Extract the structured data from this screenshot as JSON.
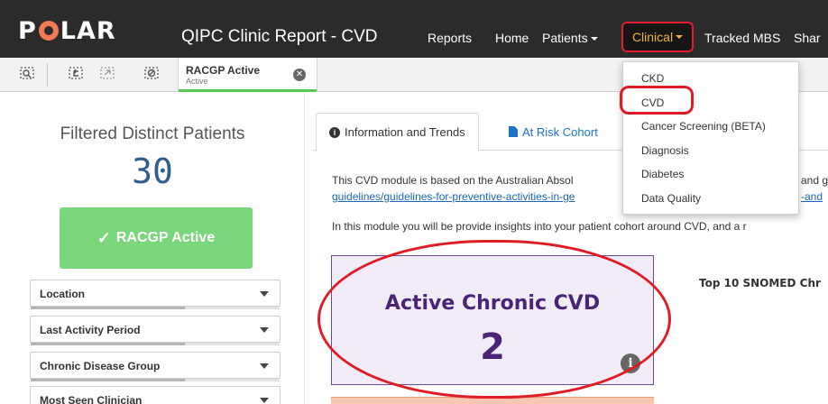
{
  "navbar": {
    "logo_text": "POLAR",
    "app_title": "QIPC Clinic Report - CVD",
    "items": [
      {
        "label": "Reports"
      },
      {
        "label": "Home"
      },
      {
        "label": "Patients"
      },
      {
        "label": "Clinical"
      },
      {
        "label": "Tracked MBS"
      },
      {
        "label": "Shar"
      }
    ],
    "active_color": "#f0b33c"
  },
  "toolbar": {
    "icons": [
      "lasso-select-icon",
      "back-step-icon",
      "forward-step-icon",
      "clear-selections-icon"
    ],
    "selection": {
      "title": "RACGP Active",
      "subtitle": "Active"
    }
  },
  "sidebar": {
    "counter_title": "Filtered Distinct Patients",
    "counter_value": "30",
    "racgp_button": "RACGP Active",
    "filters": [
      {
        "label": "Location"
      },
      {
        "label": "Last Activity Period"
      },
      {
        "label": "Chronic Disease Group"
      },
      {
        "label": "Most Seen Clinician"
      }
    ]
  },
  "tabs": [
    {
      "label": "Information and Trends"
    },
    {
      "label": "At Risk Cohort"
    }
  ],
  "content": {
    "line1": "This CVD module is based on the Australian Absol",
    "line1_right": "and g",
    "link_left": "guidelines/guidelines-for-preventive-activities-in-ge",
    "link_right": "-and",
    "line3": "In this module you will be provide insights into your patient cohort around CVD, and a r"
  },
  "kpi": {
    "title": "Active Chronic CVD",
    "value": "2"
  },
  "side_chart_title": "Top 10 SNOMED Chr",
  "dropdown": {
    "items": [
      "CKD",
      "CVD",
      "Cancer Screening (BETA)",
      "Diagnosis",
      "Diabetes",
      "Data Quality"
    ]
  },
  "colors": {
    "navbar_bg": "#2b2b2b",
    "racgp_green": "#7ad67a",
    "kpi_purple": "#4b2379",
    "annotation_red": "#e01b24"
  }
}
